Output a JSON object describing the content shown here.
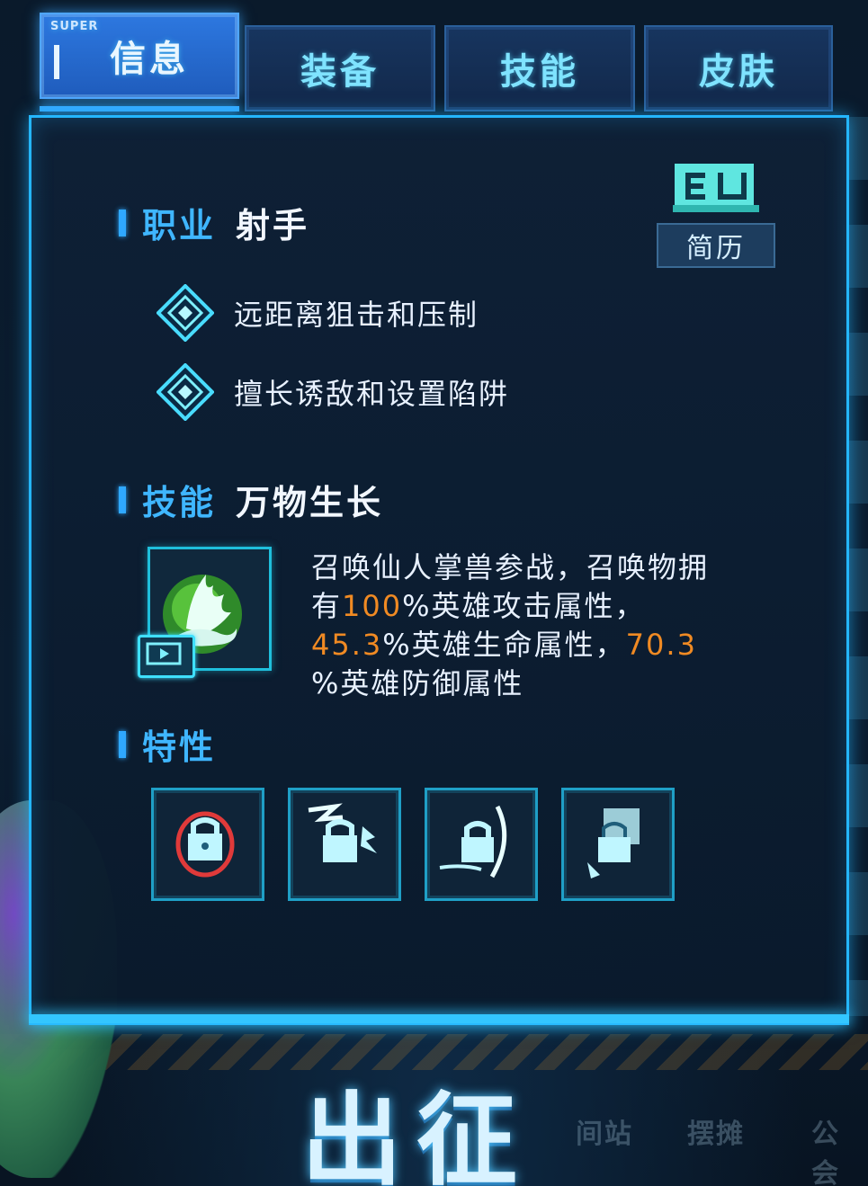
{
  "tabs": [
    {
      "label": "信息",
      "badge": "SUPER",
      "active": true
    },
    {
      "label": "装备",
      "active": false
    },
    {
      "label": "技能",
      "active": false
    },
    {
      "label": "皮肤",
      "active": false
    }
  ],
  "class_section": {
    "label": "职业",
    "value": "射手"
  },
  "resume": {
    "label": "简历",
    "icon": "book-icon"
  },
  "traits": [
    {
      "text": "远距离狙击和压制",
      "icon": "diamond-icon"
    },
    {
      "text": "擅长诱敌和设置陷阱",
      "icon": "diamond-icon"
    }
  ],
  "skill_section": {
    "label": "技能",
    "value": "万物生长"
  },
  "skill": {
    "icon": "summon-hand-icon",
    "video_icon": "video-play-icon",
    "desc_1": "召唤仙人掌兽参战，召唤物拥",
    "desc_2a": "有",
    "desc_2b": "100",
    "desc_2c": "%英雄攻击属性，",
    "desc_3a": "45.3",
    "desc_3b": "%英雄生命属性，",
    "desc_3c": "70.3",
    "desc_4": "%英雄防御属性"
  },
  "feature_section": {
    "label": "特性"
  },
  "features": [
    {
      "icon": "locked-feature-red-icon"
    },
    {
      "icon": "locked-feature-lightning-icon"
    },
    {
      "icon": "locked-feature-slash-icon"
    },
    {
      "icon": "locked-feature-boot-icon"
    }
  ],
  "bottom": {
    "go_label": "出征",
    "nav_1": "间站",
    "nav_2": "摆摊",
    "nav_3": "公会"
  },
  "colors": {
    "accent": "#24b6ff",
    "highlight": "#f08a23",
    "active_tab": "#2d78e0"
  }
}
